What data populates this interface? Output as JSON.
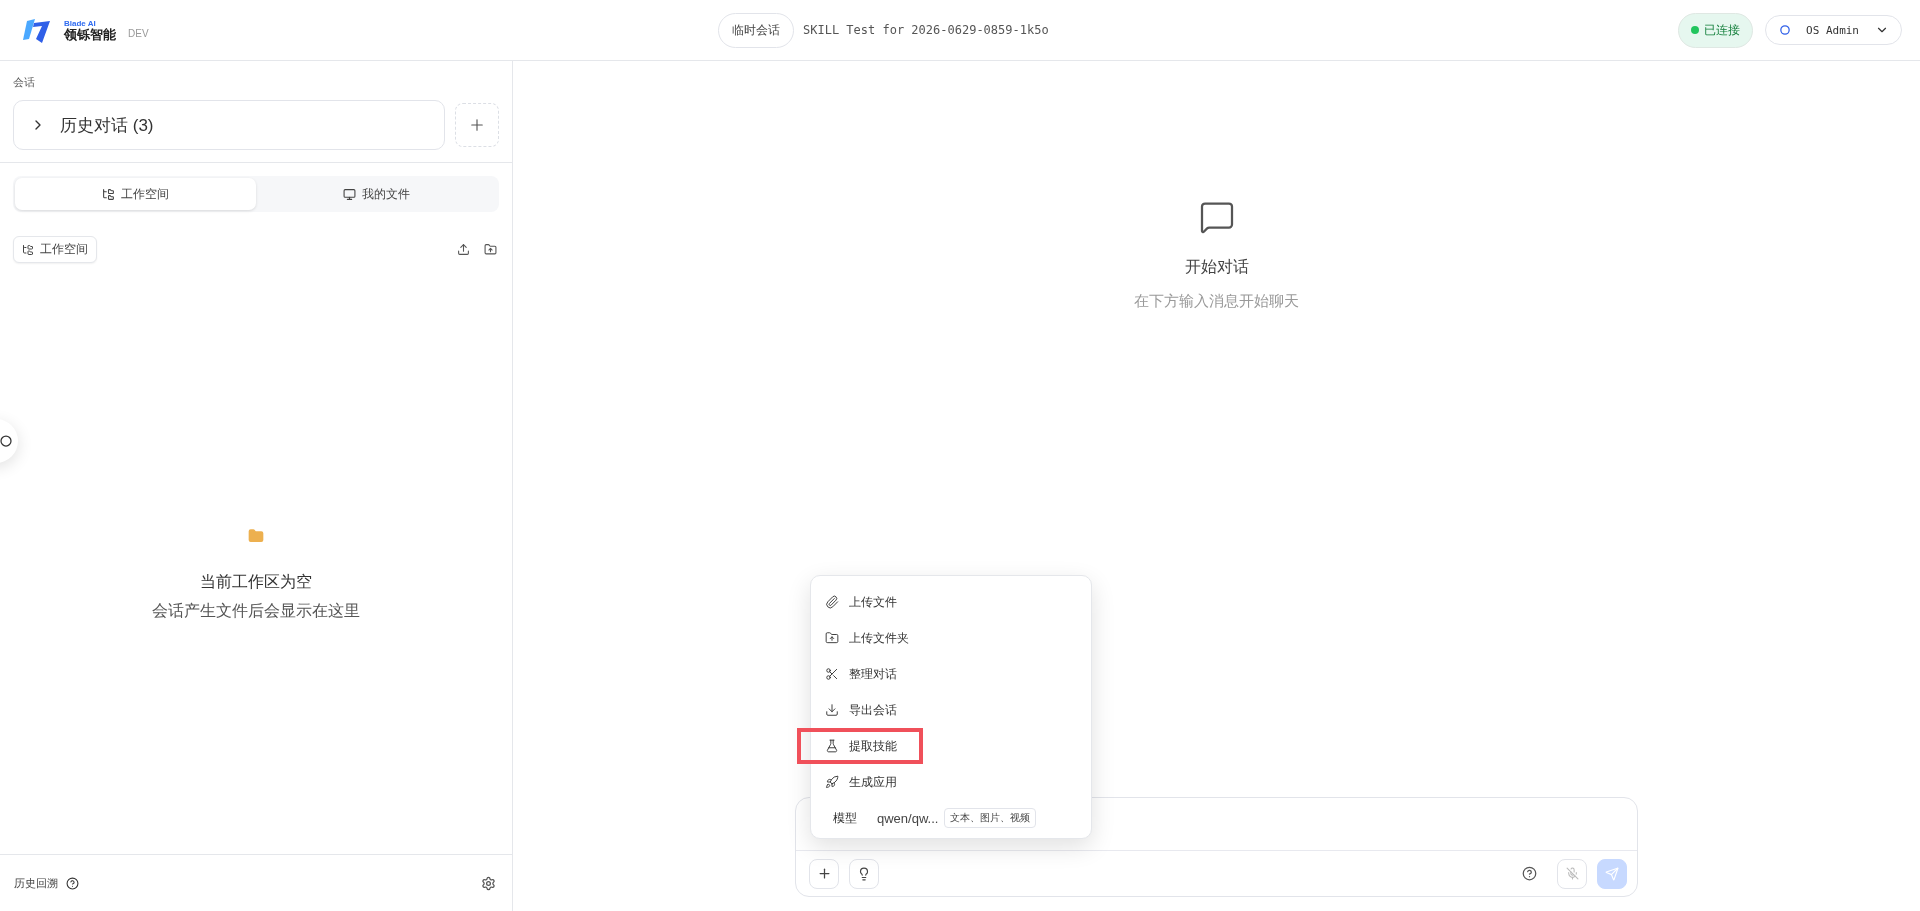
{
  "header": {
    "logo_caption": "Blade AI",
    "logo_name": "领铄智能",
    "env": "DEV",
    "session_badge": "临时会话",
    "session_title": "SKILL Test for 2026-0629-0859-1k5o",
    "status": {
      "label": "已连接",
      "connected": true
    },
    "user": {
      "name": "OS Admin"
    }
  },
  "sidebar": {
    "section_label": "会话",
    "history": {
      "label": "历史对话 (3)",
      "expanded": false
    },
    "tabs": [
      {
        "label": "工作空间",
        "selected": true
      },
      {
        "label": "我的文件",
        "selected": false
      }
    ],
    "workspace_chip": "工作空间",
    "empty": {
      "title": "当前工作区为空",
      "subtitle": "会话产生文件后会显示在这里"
    },
    "footer": {
      "label": "历史回溯"
    }
  },
  "chat": {
    "empty_title": "开始对话",
    "empty_subtitle": "在下方输入消息开始聊天"
  },
  "menu": {
    "items": [
      {
        "label": "上传文件",
        "kind": "attach",
        "highlighted": false
      },
      {
        "label": "上传文件夹",
        "kind": "folder",
        "highlighted": false
      },
      {
        "label": "整理对话",
        "kind": "trim",
        "highlighted": false
      },
      {
        "label": "导出会话",
        "kind": "export",
        "highlighted": false
      },
      {
        "label": "提取技能",
        "kind": "skill",
        "highlighted": true
      },
      {
        "label": "生成应用",
        "kind": "app",
        "highlighted": false
      }
    ],
    "model": {
      "label": "模型",
      "value": "qwen/qw...",
      "tag": "文本、图片、视频"
    }
  }
}
